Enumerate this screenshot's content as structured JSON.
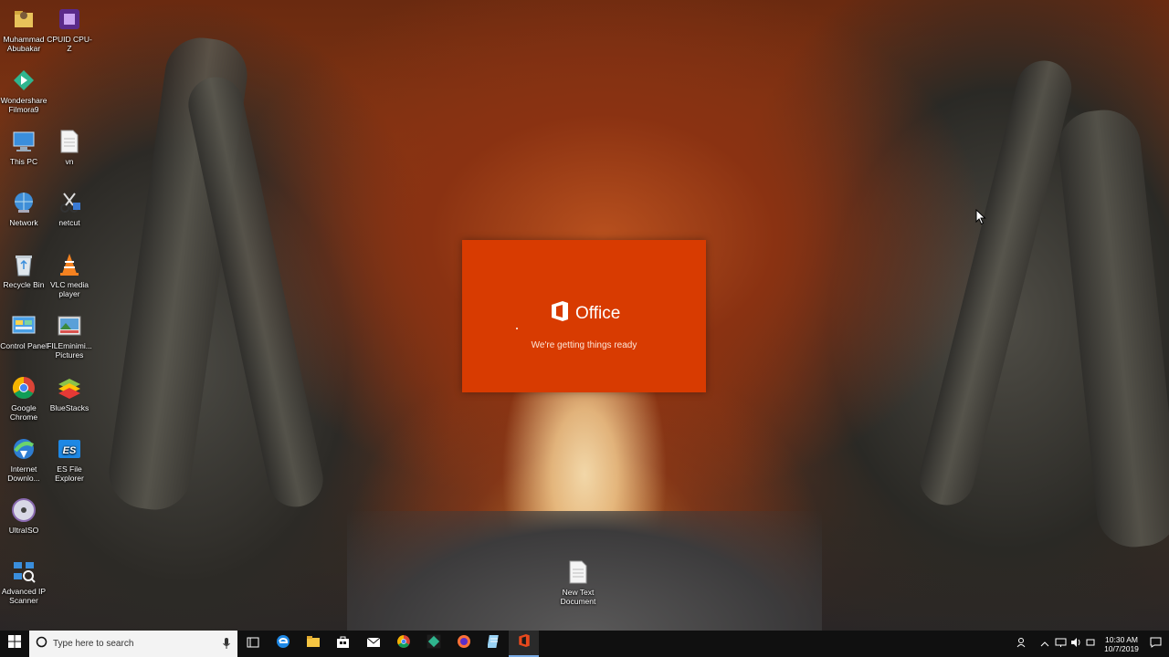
{
  "desktop": {
    "icons": [
      {
        "label": "Muhammad Abubakar",
        "icon": "user-folder-icon"
      },
      {
        "label": "CPUID CPU-Z",
        "icon": "cpuz-icon"
      },
      {
        "label": "Wondershare Filmora9",
        "icon": "filmora-icon"
      },
      {
        "label": "This PC",
        "icon": "computer-icon"
      },
      {
        "label": "vn",
        "icon": "text-file-icon"
      },
      {
        "label": "Network",
        "icon": "network-icon"
      },
      {
        "label": "netcut",
        "icon": "netcut-icon"
      },
      {
        "label": "Recycle Bin",
        "icon": "recycle-bin-icon"
      },
      {
        "label": "VLC media player",
        "icon": "vlc-icon"
      },
      {
        "label": "Control Panel",
        "icon": "control-panel-icon"
      },
      {
        "label": "FILEminimi... Pictures",
        "icon": "fileminimizer-icon"
      },
      {
        "label": "Google Chrome",
        "icon": "chrome-icon"
      },
      {
        "label": "BlueStacks",
        "icon": "bluestacks-icon"
      },
      {
        "label": "Internet Downlo...",
        "icon": "idm-icon"
      },
      {
        "label": "ES File Explorer",
        "icon": "es-file-explorer-icon"
      },
      {
        "label": "UltraISO",
        "icon": "ultraiso-icon"
      },
      {
        "label": "Advanced IP Scanner",
        "icon": "ip-scanner-icon"
      },
      {
        "label": "New Text Document",
        "icon": "text-file-icon"
      }
    ]
  },
  "splash": {
    "product": "Office",
    "status": "We're getting things ready",
    "background": "#d83b01"
  },
  "taskbar": {
    "search_placeholder": "Type here to search",
    "apps": [
      "task-view-icon",
      "edge-icon",
      "file-explorer-icon",
      "store-icon",
      "mail-icon",
      "chrome-icon",
      "filmora-icon",
      "firefox-icon",
      "notepad-icon",
      "office-icon"
    ],
    "active_app": "office-icon",
    "clock": {
      "time": "10:30 AM",
      "date": "10/7/2019"
    }
  }
}
